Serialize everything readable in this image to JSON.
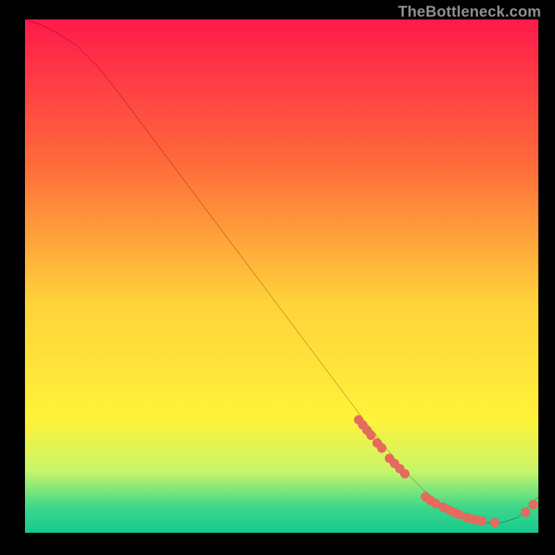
{
  "watermark": "TheBottleneck.com",
  "colors": {
    "bg": "#000000",
    "gradient_top": "#ff1a4b",
    "gradient_mid1": "#ff6a3a",
    "gradient_mid2": "#ffd23a",
    "gradient_mid3": "#fff23a",
    "gradient_green1": "#c8f56a",
    "gradient_green2": "#3dd88a",
    "gradient_green3": "#17c98d",
    "curve": "#000000",
    "marker_fill": "#e76a5e",
    "marker_stroke": "#b94e46",
    "watermark": "#8e8e8e"
  },
  "chart_data": {
    "type": "line",
    "title": "",
    "xlabel": "",
    "ylabel": "",
    "xlim": [
      0,
      100
    ],
    "ylim": [
      0,
      100
    ],
    "grid": false,
    "legend": false,
    "series": [
      {
        "name": "bottleneck-curve",
        "x": [
          0,
          3,
          6,
          10,
          14,
          18,
          24,
          30,
          36,
          42,
          48,
          54,
          60,
          66,
          70,
          74,
          78,
          82,
          86,
          90,
          93,
          96,
          98,
          100
        ],
        "y": [
          100,
          99,
          97.5,
          95,
          91,
          86,
          78,
          70,
          62,
          54,
          46,
          38,
          30,
          22,
          17,
          12,
          8,
          5,
          3,
          2,
          2,
          3,
          5,
          7
        ]
      }
    ],
    "markers": {
      "name": "data-points",
      "x": [
        65.0,
        65.8,
        66.6,
        67.4,
        68.6,
        69.5,
        71.0,
        72.0,
        73.0,
        74.0,
        78.0,
        79.0,
        80.0,
        81.5,
        82.5,
        83.5,
        84.5,
        86.0,
        87.0,
        88.0,
        89.0,
        91.5,
        97.5,
        99.0
      ],
      "y": [
        22.0,
        21.0,
        20.0,
        19.0,
        17.5,
        16.5,
        14.5,
        13.5,
        12.5,
        11.5,
        7.0,
        6.3,
        5.7,
        5.0,
        4.5,
        4.0,
        3.6,
        3.0,
        2.7,
        2.5,
        2.3,
        2.0,
        4.0,
        5.5
      ]
    }
  }
}
